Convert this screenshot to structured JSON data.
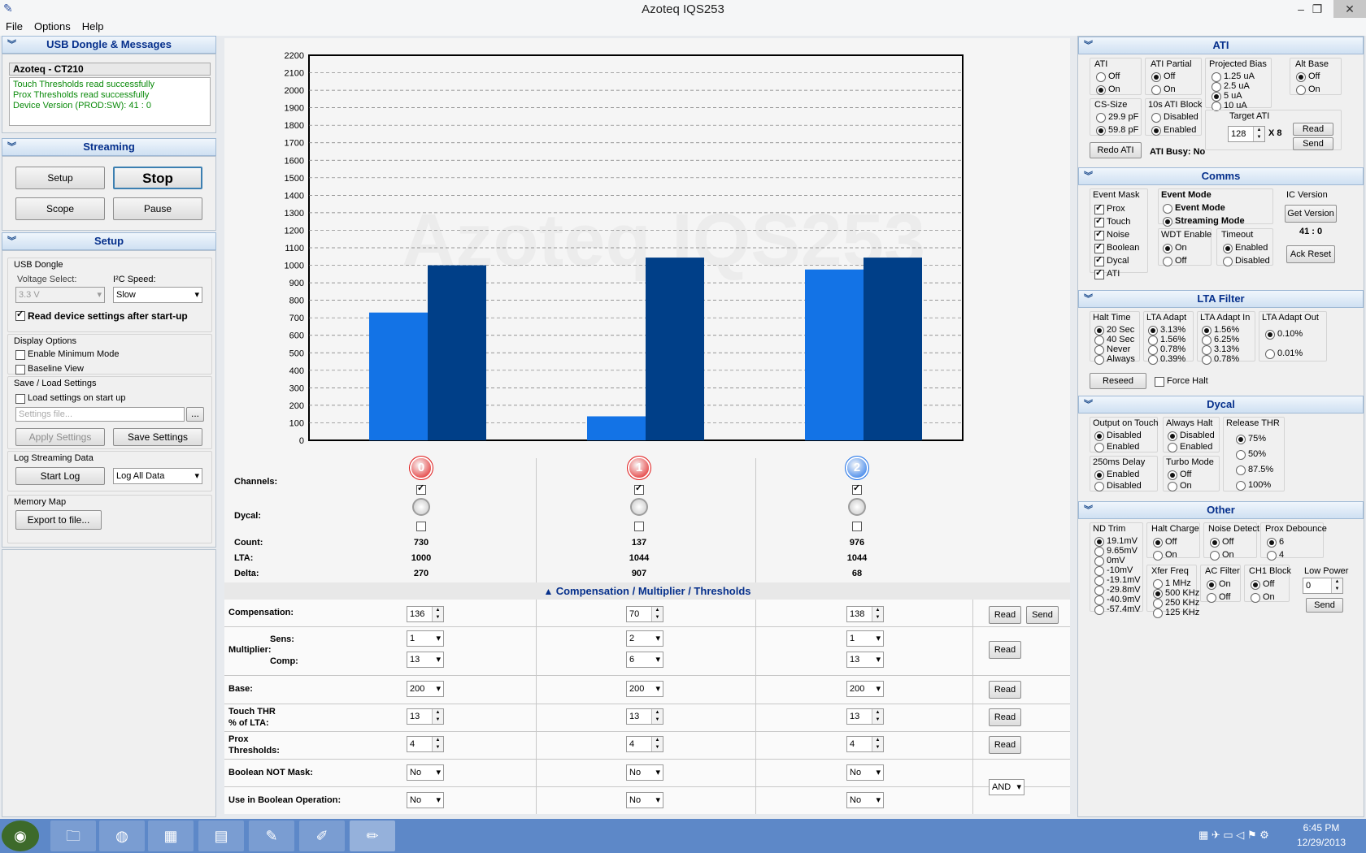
{
  "window": {
    "title": "Azoteq IQS253"
  },
  "menu": {
    "file": "File",
    "options": "Options",
    "help": "Help"
  },
  "left": {
    "usb_header": "USB Dongle & Messages",
    "device": "Azoteq - CT210",
    "messages": [
      "Touch Thresholds read successfully",
      "Prox Thresholds read successfully",
      "Device Version (PROD:SW):   41 : 0"
    ],
    "streaming_header": "Streaming",
    "setup_btn": "Setup",
    "stop_btn": "Stop",
    "scope_btn": "Scope",
    "pause_btn": "Pause",
    "setup_header": "Setup",
    "usb_dongle": "USB Dongle",
    "voltage_select": "Voltage Select:",
    "voltage": "3.3 V",
    "i2c_speed": "I²C Speed:",
    "i2c": "Slow",
    "read_settings": "Read device settings after start-up",
    "display_options": "Display Options",
    "min_mode": "Enable Minimum Mode",
    "baseline_view": "Baseline View",
    "save_load": "Save / Load Settings",
    "load_on_start": "Load settings on start up",
    "settings_placeholder": "Settings file...",
    "browse": "...",
    "apply_settings": "Apply Settings",
    "save_settings": "Save Settings",
    "log_streaming": "Log Streaming Data",
    "start_log": "Start Log",
    "log_mode": "Log All Data",
    "memory_map": "Memory Map",
    "export": "Export to file..."
  },
  "chart_data": {
    "type": "bar",
    "categories": [
      "0",
      "1",
      "2"
    ],
    "series": [
      {
        "name": "Count",
        "values": [
          730,
          137,
          976
        ]
      },
      {
        "name": "LTA",
        "values": [
          1000,
          1044,
          1044
        ]
      }
    ],
    "ylim": [
      0,
      2200
    ],
    "yticks": [
      0,
      100,
      200,
      300,
      400,
      500,
      600,
      700,
      800,
      900,
      1000,
      1100,
      1200,
      1300,
      1400,
      1500,
      1600,
      1700,
      1800,
      1900,
      2000,
      2100,
      2200
    ],
    "grid": true,
    "colors": [
      "#1373e6",
      "#003f88"
    ]
  },
  "channels": {
    "labels": {
      "channels": "Channels:",
      "dycal": "Dycal:",
      "count": "Count:",
      "lta": "LTA:",
      "delta": "Delta:"
    },
    "items": [
      {
        "id": "0",
        "count": "730",
        "lta": "1000",
        "delta": "270",
        "color": "#e01818"
      },
      {
        "id": "1",
        "count": "137",
        "lta": "1044",
        "delta": "907",
        "color": "#e01818"
      },
      {
        "id": "2",
        "count": "976",
        "lta": "1044",
        "delta": "68",
        "color": "#1a6fe8"
      }
    ]
  },
  "table": {
    "title": "Compensation / Multiplier / Thresholds",
    "compensation": "Compensation:",
    "multiplier": "Multiplier:",
    "sens": "Sens:",
    "comp": "Comp:",
    "base": "Base:",
    "touch_thr": "Touch THR",
    "pct_lta": "% of LTA:",
    "prox": "Prox",
    "thresholds": "Thresholds:",
    "bool_not": "Boolean NOT Mask:",
    "use_bool": "Use in Boolean Operation:",
    "read": "Read",
    "send": "Send",
    "bool_op": "AND",
    "cols": [
      {
        "comp": "136",
        "sens": "1",
        "compm": "13",
        "base": "200",
        "touch": "13",
        "prox": "4",
        "notmask": "No",
        "usebool": "No"
      },
      {
        "comp": "70",
        "sens": "2",
        "compm": "6",
        "base": "200",
        "touch": "13",
        "prox": "4",
        "notmask": "No",
        "usebool": "No"
      },
      {
        "comp": "138",
        "sens": "1",
        "compm": "13",
        "base": "200",
        "touch": "13",
        "prox": "4",
        "notmask": "No",
        "usebool": "No"
      }
    ]
  },
  "right": {
    "ati_header": "ATI",
    "ati": "ATI",
    "off": "Off",
    "on": "On",
    "ati_partial": "ATI Partial",
    "proj_bias": "Projected Bias",
    "bias": [
      "1.25 uA",
      "2.5 uA",
      "5 uA",
      "10 uA"
    ],
    "alt_base": "Alt Base",
    "cs_size": "CS-Size",
    "cs": [
      "29.9 pF",
      "59.8 pF"
    ],
    "ati_block": "10s ATI Block",
    "disabled": "Disabled",
    "enabled": "Enabled",
    "target_ati": "Target ATI",
    "target": "128",
    "x8": "X 8",
    "read": "Read",
    "send": "Send",
    "redo_ati": "Redo ATI",
    "ati_busy": "ATI Busy:  No",
    "comms_header": "Comms",
    "event_mask": "Event Mask",
    "masks": [
      "Prox",
      "Touch",
      "Noise",
      "Boolean",
      "Dycal",
      "ATI"
    ],
    "event_mode_lbl": "Event Mode",
    "event_mode": "Event Mode",
    "streaming_mode": "Streaming Mode",
    "ic_version": "IC Version",
    "get_version": "Get Version",
    "version": "41 : 0",
    "wdt": "WDT Enable",
    "timeout": "Timeout",
    "ack_reset": "Ack Reset",
    "lta_header": "LTA Filter",
    "halt_time": "Halt Time",
    "halts": [
      "20 Sec",
      "40 Sec",
      "Never",
      "Always"
    ],
    "lta_adapt": "LTA Adapt",
    "adapts": [
      "3.13%",
      "1.56%",
      "0.78%",
      "0.39%"
    ],
    "lta_adapt_in": "LTA Adapt In",
    "adapt_in": [
      "1.56%",
      "6.25%",
      "3.13%",
      "0.78%"
    ],
    "lta_adapt_out": "LTA Adapt Out",
    "adapt_out": [
      "0.10%",
      "0.01%"
    ],
    "reseed": "Reseed",
    "force_halt": "Force Halt",
    "dycal_header": "Dycal",
    "output_touch": "Output on Touch",
    "always_halt": "Always Halt",
    "release_thr": "Release THR",
    "release": [
      "75%",
      "50%",
      "87.5%",
      "100%"
    ],
    "delay": "250ms Delay",
    "turbo": "Turbo Mode",
    "other_header": "Other",
    "nd_trim": "ND Trim",
    "nd": [
      "19.1mV",
      "9.65mV",
      "0mV",
      "-10mV",
      "-19.1mV",
      "-29.8mV",
      "-40.9mV",
      "-57.4mV"
    ],
    "halt_charge": "Halt Charge",
    "noise_detect": "Noise Detect",
    "prox_debounce": "Prox Debounce",
    "deb": [
      "6",
      "4"
    ],
    "xfer": "Xfer Freq",
    "xf": [
      "1 MHz",
      "500 KHz",
      "250 KHz",
      "125 KHz"
    ],
    "ac_filter": "AC Filter",
    "ch1_block": "CH1 Block",
    "low_power": "Low Power",
    "lp": "0"
  },
  "taskbar": {
    "time": "6:45 PM",
    "date": "12/29/2013"
  }
}
